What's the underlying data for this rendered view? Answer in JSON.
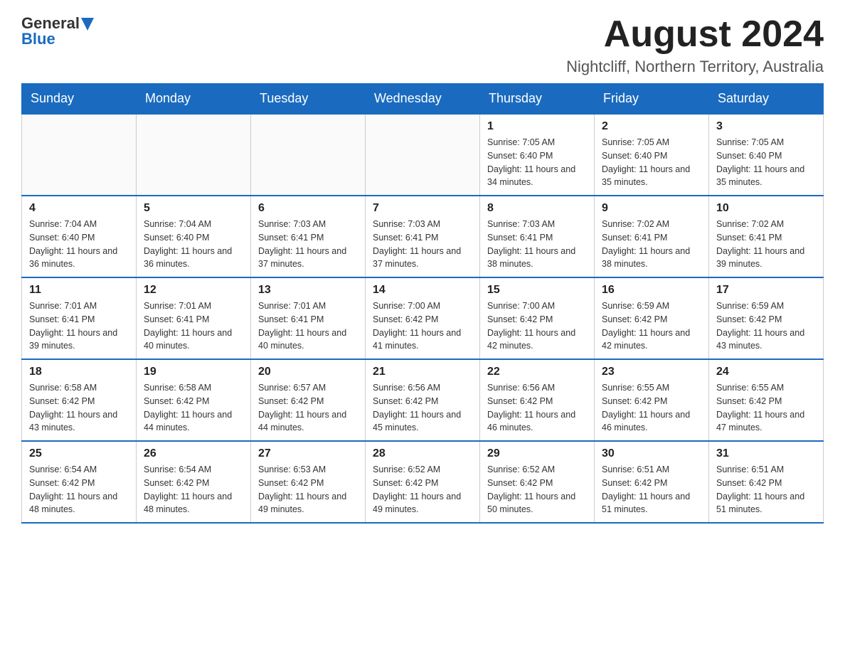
{
  "header": {
    "logo_general": "General",
    "logo_blue": "Blue",
    "month_year": "August 2024",
    "location": "Nightcliff, Northern Territory, Australia"
  },
  "days_of_week": [
    "Sunday",
    "Monday",
    "Tuesday",
    "Wednesday",
    "Thursday",
    "Friday",
    "Saturday"
  ],
  "weeks": [
    [
      {
        "day": "",
        "sunrise": "",
        "sunset": "",
        "daylight": ""
      },
      {
        "day": "",
        "sunrise": "",
        "sunset": "",
        "daylight": ""
      },
      {
        "day": "",
        "sunrise": "",
        "sunset": "",
        "daylight": ""
      },
      {
        "day": "",
        "sunrise": "",
        "sunset": "",
        "daylight": ""
      },
      {
        "day": "1",
        "sunrise": "Sunrise: 7:05 AM",
        "sunset": "Sunset: 6:40 PM",
        "daylight": "Daylight: 11 hours and 34 minutes."
      },
      {
        "day": "2",
        "sunrise": "Sunrise: 7:05 AM",
        "sunset": "Sunset: 6:40 PM",
        "daylight": "Daylight: 11 hours and 35 minutes."
      },
      {
        "day": "3",
        "sunrise": "Sunrise: 7:05 AM",
        "sunset": "Sunset: 6:40 PM",
        "daylight": "Daylight: 11 hours and 35 minutes."
      }
    ],
    [
      {
        "day": "4",
        "sunrise": "Sunrise: 7:04 AM",
        "sunset": "Sunset: 6:40 PM",
        "daylight": "Daylight: 11 hours and 36 minutes."
      },
      {
        "day": "5",
        "sunrise": "Sunrise: 7:04 AM",
        "sunset": "Sunset: 6:40 PM",
        "daylight": "Daylight: 11 hours and 36 minutes."
      },
      {
        "day": "6",
        "sunrise": "Sunrise: 7:03 AM",
        "sunset": "Sunset: 6:41 PM",
        "daylight": "Daylight: 11 hours and 37 minutes."
      },
      {
        "day": "7",
        "sunrise": "Sunrise: 7:03 AM",
        "sunset": "Sunset: 6:41 PM",
        "daylight": "Daylight: 11 hours and 37 minutes."
      },
      {
        "day": "8",
        "sunrise": "Sunrise: 7:03 AM",
        "sunset": "Sunset: 6:41 PM",
        "daylight": "Daylight: 11 hours and 38 minutes."
      },
      {
        "day": "9",
        "sunrise": "Sunrise: 7:02 AM",
        "sunset": "Sunset: 6:41 PM",
        "daylight": "Daylight: 11 hours and 38 minutes."
      },
      {
        "day": "10",
        "sunrise": "Sunrise: 7:02 AM",
        "sunset": "Sunset: 6:41 PM",
        "daylight": "Daylight: 11 hours and 39 minutes."
      }
    ],
    [
      {
        "day": "11",
        "sunrise": "Sunrise: 7:01 AM",
        "sunset": "Sunset: 6:41 PM",
        "daylight": "Daylight: 11 hours and 39 minutes."
      },
      {
        "day": "12",
        "sunrise": "Sunrise: 7:01 AM",
        "sunset": "Sunset: 6:41 PM",
        "daylight": "Daylight: 11 hours and 40 minutes."
      },
      {
        "day": "13",
        "sunrise": "Sunrise: 7:01 AM",
        "sunset": "Sunset: 6:41 PM",
        "daylight": "Daylight: 11 hours and 40 minutes."
      },
      {
        "day": "14",
        "sunrise": "Sunrise: 7:00 AM",
        "sunset": "Sunset: 6:42 PM",
        "daylight": "Daylight: 11 hours and 41 minutes."
      },
      {
        "day": "15",
        "sunrise": "Sunrise: 7:00 AM",
        "sunset": "Sunset: 6:42 PM",
        "daylight": "Daylight: 11 hours and 42 minutes."
      },
      {
        "day": "16",
        "sunrise": "Sunrise: 6:59 AM",
        "sunset": "Sunset: 6:42 PM",
        "daylight": "Daylight: 11 hours and 42 minutes."
      },
      {
        "day": "17",
        "sunrise": "Sunrise: 6:59 AM",
        "sunset": "Sunset: 6:42 PM",
        "daylight": "Daylight: 11 hours and 43 minutes."
      }
    ],
    [
      {
        "day": "18",
        "sunrise": "Sunrise: 6:58 AM",
        "sunset": "Sunset: 6:42 PM",
        "daylight": "Daylight: 11 hours and 43 minutes."
      },
      {
        "day": "19",
        "sunrise": "Sunrise: 6:58 AM",
        "sunset": "Sunset: 6:42 PM",
        "daylight": "Daylight: 11 hours and 44 minutes."
      },
      {
        "day": "20",
        "sunrise": "Sunrise: 6:57 AM",
        "sunset": "Sunset: 6:42 PM",
        "daylight": "Daylight: 11 hours and 44 minutes."
      },
      {
        "day": "21",
        "sunrise": "Sunrise: 6:56 AM",
        "sunset": "Sunset: 6:42 PM",
        "daylight": "Daylight: 11 hours and 45 minutes."
      },
      {
        "day": "22",
        "sunrise": "Sunrise: 6:56 AM",
        "sunset": "Sunset: 6:42 PM",
        "daylight": "Daylight: 11 hours and 46 minutes."
      },
      {
        "day": "23",
        "sunrise": "Sunrise: 6:55 AM",
        "sunset": "Sunset: 6:42 PM",
        "daylight": "Daylight: 11 hours and 46 minutes."
      },
      {
        "day": "24",
        "sunrise": "Sunrise: 6:55 AM",
        "sunset": "Sunset: 6:42 PM",
        "daylight": "Daylight: 11 hours and 47 minutes."
      }
    ],
    [
      {
        "day": "25",
        "sunrise": "Sunrise: 6:54 AM",
        "sunset": "Sunset: 6:42 PM",
        "daylight": "Daylight: 11 hours and 48 minutes."
      },
      {
        "day": "26",
        "sunrise": "Sunrise: 6:54 AM",
        "sunset": "Sunset: 6:42 PM",
        "daylight": "Daylight: 11 hours and 48 minutes."
      },
      {
        "day": "27",
        "sunrise": "Sunrise: 6:53 AM",
        "sunset": "Sunset: 6:42 PM",
        "daylight": "Daylight: 11 hours and 49 minutes."
      },
      {
        "day": "28",
        "sunrise": "Sunrise: 6:52 AM",
        "sunset": "Sunset: 6:42 PM",
        "daylight": "Daylight: 11 hours and 49 minutes."
      },
      {
        "day": "29",
        "sunrise": "Sunrise: 6:52 AM",
        "sunset": "Sunset: 6:42 PM",
        "daylight": "Daylight: 11 hours and 50 minutes."
      },
      {
        "day": "30",
        "sunrise": "Sunrise: 6:51 AM",
        "sunset": "Sunset: 6:42 PM",
        "daylight": "Daylight: 11 hours and 51 minutes."
      },
      {
        "day": "31",
        "sunrise": "Sunrise: 6:51 AM",
        "sunset": "Sunset: 6:42 PM",
        "daylight": "Daylight: 11 hours and 51 minutes."
      }
    ]
  ]
}
